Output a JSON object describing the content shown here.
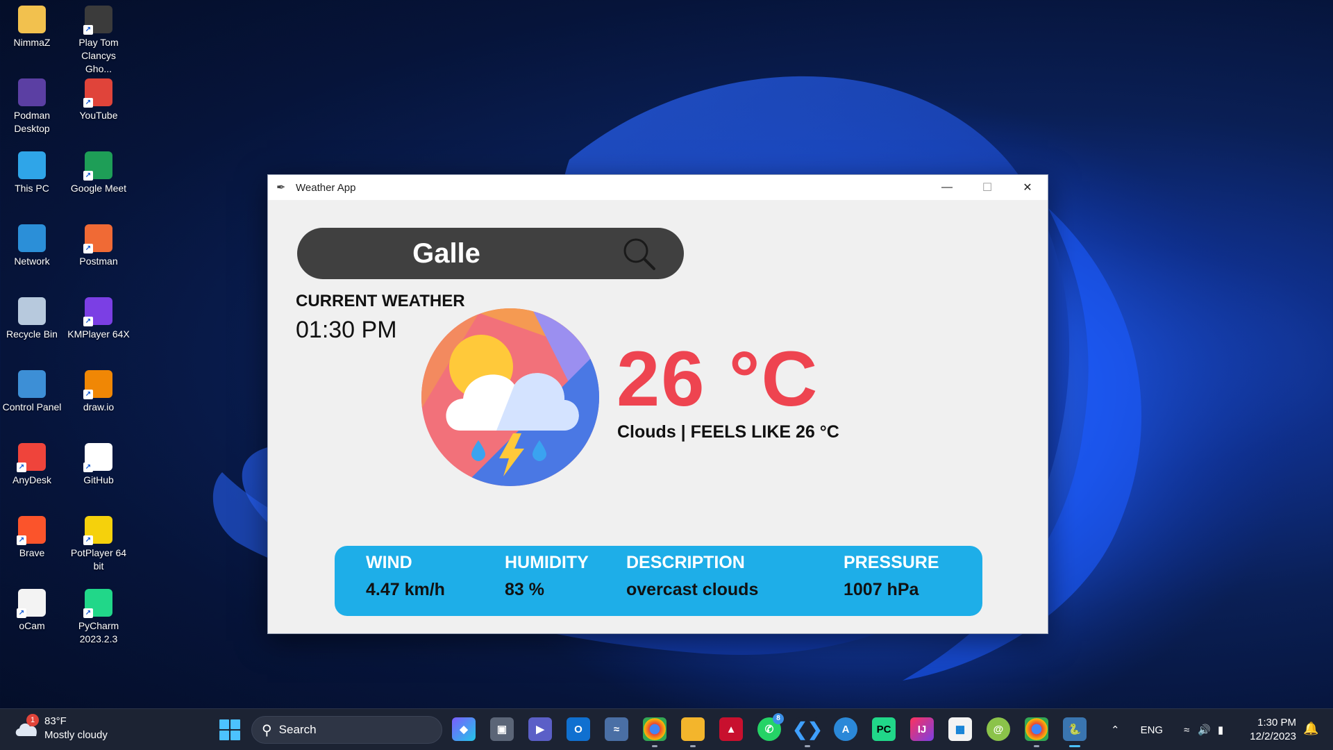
{
  "desktop": {
    "icons": [
      {
        "label": "NimmaZ",
        "icon": "folder-icon",
        "color": "#f2c14e"
      },
      {
        "label": "Play Tom Clancys Gho...",
        "icon": "game-icon",
        "color": "#3b3b3b"
      },
      {
        "label": "Podman Desktop",
        "icon": "podman-icon",
        "color": "#5b3fa3"
      },
      {
        "label": "YouTube",
        "icon": "chrome-icon",
        "color": "#e0443a"
      },
      {
        "label": "This PC",
        "icon": "monitor-icon",
        "color": "#2fa5e8"
      },
      {
        "label": "Google Meet",
        "icon": "meet-icon",
        "color": "#1e9e57"
      },
      {
        "label": "Network",
        "icon": "network-icon",
        "color": "#2b8fd8"
      },
      {
        "label": "Postman",
        "icon": "postman-icon",
        "color": "#f06a35"
      },
      {
        "label": "Recycle Bin",
        "icon": "recycle-bin-icon",
        "color": "#b7c9dd"
      },
      {
        "label": "KMPlayer 64X",
        "icon": "kmplayer-icon",
        "color": "#7b3fe4"
      },
      {
        "label": "Control Panel",
        "icon": "control-panel-icon",
        "color": "#3d8fd6"
      },
      {
        "label": "draw.io",
        "icon": "drawio-icon",
        "color": "#f08705"
      },
      {
        "label": "AnyDesk",
        "icon": "anydesk-icon",
        "color": "#ef443b"
      },
      {
        "label": "GitHub",
        "icon": "github-icon",
        "color": "#ffffff"
      },
      {
        "label": "Brave",
        "icon": "brave-icon",
        "color": "#fb542b"
      },
      {
        "label": "PotPlayer 64 bit",
        "icon": "potplayer-icon",
        "color": "#f5d10c"
      },
      {
        "label": "oCam",
        "icon": "ocam-icon",
        "color": "#f3f3f3"
      },
      {
        "label": "PyCharm 2023.2.3",
        "icon": "pycharm-icon",
        "color": "#21d789"
      }
    ]
  },
  "window": {
    "title": "Weather App",
    "search_value": "Galle",
    "current_weather_label": "CURRENT WEATHER",
    "time": "01:30 PM",
    "temperature": "26 °C",
    "condition_line": "Clouds | FEELS LIKE 26 °C",
    "info": [
      {
        "heading": "WIND",
        "value": "4.47 km/h"
      },
      {
        "heading": "HUMIDITY",
        "value": "83 %"
      },
      {
        "heading": "DESCRIPTION",
        "value": "overcast clouds"
      },
      {
        "heading": "PRESSURE",
        "value": "1007 hPa"
      }
    ]
  },
  "taskbar": {
    "weather_temp": "83°F",
    "weather_desc": "Mostly cloudy",
    "weather_badge": "1",
    "search_label": "Search",
    "whatsapp_badge": "8",
    "language": "ENG",
    "time": "1:30 PM",
    "date": "12/2/2023"
  }
}
